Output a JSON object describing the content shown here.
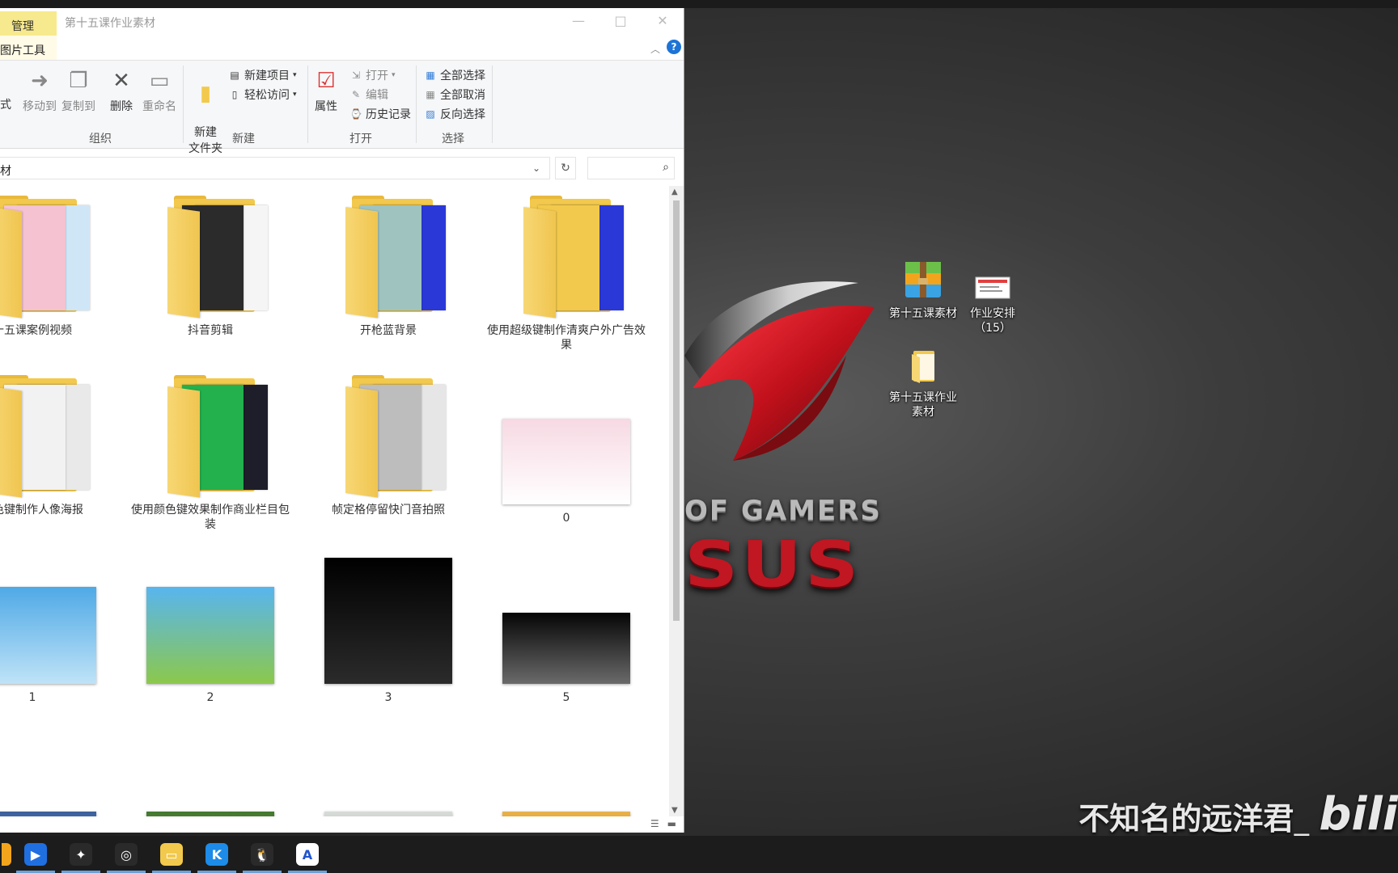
{
  "window": {
    "context_tab": "管理",
    "title": "第十五课作业素材",
    "tool_tab": "图片工具",
    "controls": {
      "minimize": "—",
      "maximize": "□",
      "close": "✕"
    }
  },
  "ribbon": {
    "edge_text": "式",
    "organize": {
      "label": "组织",
      "move_to": "移动到",
      "copy_to": "复制到",
      "delete": "删除",
      "rename": "重命名"
    },
    "new": {
      "label": "新建",
      "new_folder": "新建\n文件夹",
      "new_item": "新建项目",
      "easy_access": "轻松访问"
    },
    "open": {
      "label": "打开",
      "properties": "属性",
      "open": "打开",
      "edit": "编辑",
      "history": "历史记录"
    },
    "select": {
      "label": "选择",
      "select_all": "全部选择",
      "select_none": "全部取消",
      "invert": "反向选择"
    }
  },
  "address": {
    "path": "材",
    "search_placeholder": ""
  },
  "items": [
    {
      "name": "十五课案例视频",
      "kind": "folder",
      "colors": [
        "#f4c2d0",
        "#cfe6f7"
      ]
    },
    {
      "name": "抖音剪辑",
      "kind": "folder",
      "colors": [
        "#2b2b2b",
        "#f5f5f5"
      ]
    },
    {
      "name": "开枪蓝背景",
      "kind": "folder",
      "colors": [
        "#9fc4c0",
        "#2a38d8"
      ]
    },
    {
      "name": "使用超级键制作清爽户外广告效果",
      "kind": "folder",
      "colors": [
        "#f2c94c",
        "#2a38d8"
      ]
    },
    {
      "name": "红色键制作人像海报",
      "kind": "folder",
      "colors": [
        "#f2f2f2",
        "#e9e9e9"
      ]
    },
    {
      "name": "使用颜色键效果制作商业栏目包装",
      "kind": "folder",
      "colors": [
        "#22b14c",
        "#1e1e2a"
      ]
    },
    {
      "name": "帧定格停留快门音拍照",
      "kind": "folder",
      "colors": [
        "#bdbdbd",
        "#e6e6e6"
      ]
    },
    {
      "name": "0",
      "kind": "image",
      "colors": [
        "#f7d9e2",
        "#ffffff"
      ]
    },
    {
      "name": "1",
      "kind": "image",
      "colors": [
        "#4fa9e6",
        "#bfe3f7"
      ]
    },
    {
      "name": "2",
      "kind": "image",
      "colors": [
        "#58b5ef",
        "#8cc84b"
      ]
    },
    {
      "name": "3",
      "kind": "image",
      "colors": [
        "#000000",
        "#2b2b2b"
      ]
    },
    {
      "name": "5",
      "kind": "image",
      "colors": [
        "#050505",
        "#6a6a6a"
      ]
    },
    {
      "name": "",
      "kind": "image",
      "colors": [
        "#3c5f9c",
        "#7aa2cf"
      ]
    },
    {
      "name": "",
      "kind": "image",
      "colors": [
        "#3f7a2c",
        "#e86f9a"
      ]
    },
    {
      "name": "",
      "kind": "image",
      "colors": [
        "#d8dcd8",
        "#9aa39d"
      ]
    },
    {
      "name": "",
      "kind": "image",
      "colors": [
        "#e8b24a",
        "#c07a24"
      ]
    }
  ],
  "desktop": {
    "brand_line": "OF GAMERS",
    "brand_word": "SUS",
    "icons": [
      {
        "label": "第十五课素材",
        "icon": "winrar-archive-icon"
      },
      {
        "label": "作业安排（15）",
        "icon": "document-icon"
      },
      {
        "label": "第十五课作业素材",
        "icon": "folder-icon"
      }
    ],
    "watermark": "不知名的远洋君_",
    "watermark_logo": "bili"
  },
  "taskbar": {
    "apps": [
      {
        "name": "partial-app",
        "color": "#f2a51c",
        "glyph": ""
      },
      {
        "name": "app-blue",
        "color": "#1f6fe0",
        "glyph": "▶"
      },
      {
        "name": "app-feather",
        "color": "#2a2a2a",
        "glyph": "✦"
      },
      {
        "name": "obs",
        "color": "#2a2a2a",
        "glyph": "◎"
      },
      {
        "name": "file-explorer",
        "color": "#f2c94c",
        "glyph": "▭"
      },
      {
        "name": "kugou",
        "color": "#1d8be8",
        "glyph": "K"
      },
      {
        "name": "qq",
        "color": "#2a2a2a",
        "glyph": "🐧"
      },
      {
        "name": "app-a",
        "color": "#ffffff",
        "glyph": "A"
      }
    ]
  }
}
